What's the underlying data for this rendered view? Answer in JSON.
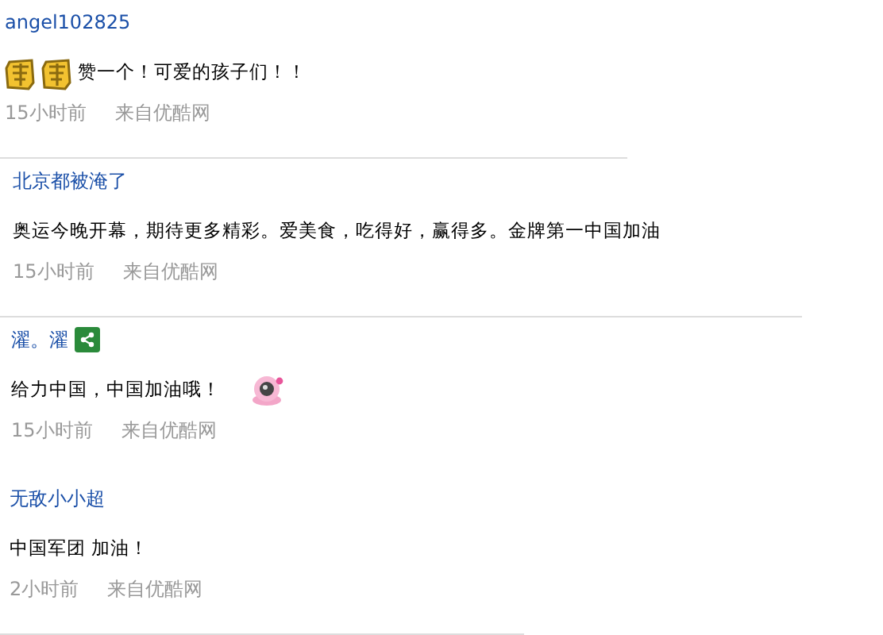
{
  "comments": [
    {
      "user": "angel102825",
      "share": false,
      "body": [
        {
          "kind": "zan"
        },
        {
          "kind": "zan"
        },
        {
          "kind": "text",
          "text": "赞一个！可爱的孩子们！！"
        }
      ],
      "time": "15小时前",
      "source": "来自优酷网",
      "divider": true
    },
    {
      "user": "北京都被淹了",
      "share": false,
      "body": [
        {
          "kind": "text",
          "text": "奥运今晚开幕，期待更多精彩。爱美食，吃得好，赢得多。金牌第一中国加油"
        }
      ],
      "time": "15小时前",
      "source": "来自优酷网",
      "divider": true
    },
    {
      "user": "濯。濯",
      "share": true,
      "body": [
        {
          "kind": "text",
          "text": "给力中国，中国加油哦！"
        },
        {
          "kind": "camera"
        }
      ],
      "time": "15小时前",
      "source": "来自优酷网",
      "divider": false
    },
    {
      "user": "无敌小小超",
      "share": false,
      "body": [
        {
          "kind": "text",
          "text": "中国军团 加油！"
        }
      ],
      "time": "2小时前",
      "source": "来自优酷网",
      "divider": true
    }
  ]
}
